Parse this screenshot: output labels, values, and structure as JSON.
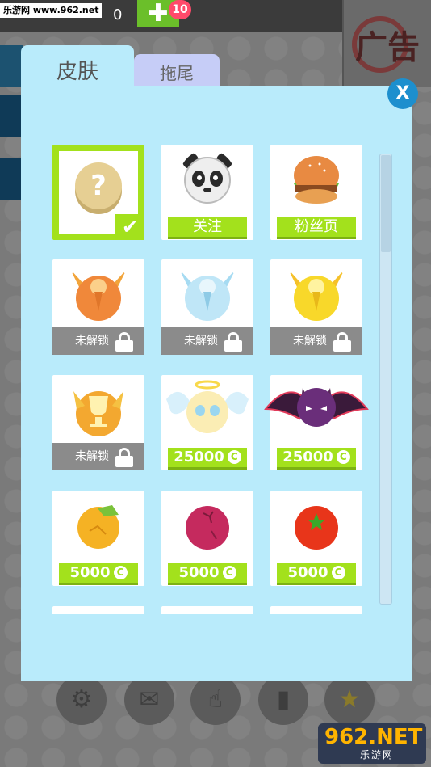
{
  "header": {
    "watermark": "乐游网 www.962.net",
    "coins": "0",
    "plus_symbol": "✚",
    "notification_count": "10",
    "ad_text": "广告"
  },
  "tabs": [
    {
      "label": "皮肤",
      "active": true
    },
    {
      "label": "拖尾",
      "active": false
    }
  ],
  "close_label": "X",
  "currency_symbol": "C",
  "items": [
    {
      "name": "mystery",
      "type": "selected",
      "symbol": "?",
      "check": "✔"
    },
    {
      "name": "panda",
      "type": "action",
      "label": "关注"
    },
    {
      "name": "burger",
      "type": "action",
      "label": "粉丝页"
    },
    {
      "name": "bronze-medal",
      "type": "locked",
      "label": "未解锁"
    },
    {
      "name": "silver-medal",
      "type": "locked",
      "label": "未解锁"
    },
    {
      "name": "gold-medal",
      "type": "locked",
      "label": "未解锁"
    },
    {
      "name": "trophy",
      "type": "locked",
      "label": "未解锁"
    },
    {
      "name": "angel",
      "type": "price",
      "label": "25000"
    },
    {
      "name": "devil",
      "type": "price",
      "label": "25000"
    },
    {
      "name": "orange",
      "type": "price",
      "label": "5000"
    },
    {
      "name": "plum",
      "type": "price",
      "label": "5000"
    },
    {
      "name": "tomato",
      "type": "price",
      "label": "5000"
    }
  ],
  "bottom_nav": [
    "gear-icon",
    "mail-icon",
    "hand-pointer-icon",
    "leaderboard-icon",
    "star-icon"
  ],
  "brand": {
    "big": "962.NET",
    "small": "乐游网"
  },
  "colors": {
    "panel": "#b9ebfb",
    "accent_green": "#a3e11c",
    "close_blue": "#1d8fce"
  }
}
